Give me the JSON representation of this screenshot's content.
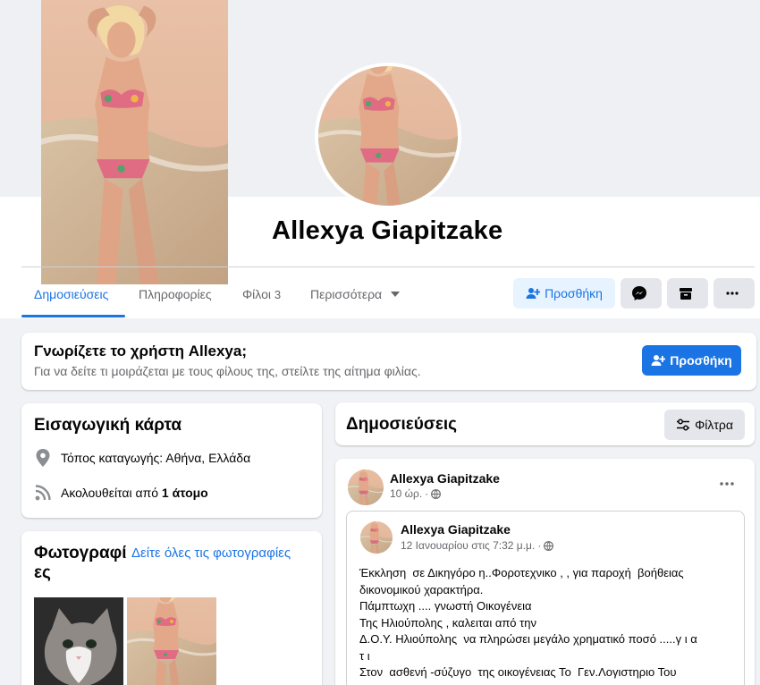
{
  "profile": {
    "name": "Allexya Giapitzake"
  },
  "tabs": [
    {
      "label": "Δημοσιεύσεις"
    },
    {
      "label": "Πληροφορίες"
    },
    {
      "label": "Φίλοι",
      "count": "3"
    },
    {
      "label": "Περισσότερα"
    }
  ],
  "header_actions": {
    "add_friend_label": "Προσθήκη"
  },
  "know_card": {
    "title": "Γνωρίζετε το χρήστη Allexya;",
    "subtitle": "Για να δείτε τι μοιράζεται με τους φίλους της, στείλτε της αίτημα φιλίας.",
    "button_label": "Προσθήκη"
  },
  "intro": {
    "title": "Εισαγωγική κάρτα",
    "hometown": "Τόπος καταγωγής: Αθήνα, Ελλάδα",
    "followed_prefix": "Ακολουθείται από ",
    "followed_count": "1 άτομο"
  },
  "photos": {
    "title": "Φωτογραφίες",
    "see_all": "Δείτε όλες τις φωτογραφίες"
  },
  "posts_header": {
    "title": "Δημοσιεύσεις",
    "filter_label": "Φίλτρα"
  },
  "post": {
    "author": "Allexya Giapitzake",
    "time": "10 ώρ.",
    "shared": {
      "author": "Allexya Giapitzake",
      "time": "12 Ιανουαρίου στις 7:32 μ.μ.",
      "lines": [
        "Έκκληση  σε Δικηγόρο η..Φοροτεχνικο , , για παροχή  βοήθειας",
        "δικονομικού χαρακτήρα.",
        "Πάμπτωχη .... γνωστή Οικογένεια",
        "Της Ηλιούπολης , καλειται από την",
        "Δ.Ο.Υ. Ηλιούπολης  να πληρώσει μεγάλο χρηματικό ποσό .....γ ι α",
        "τ ι",
        "Στον  ασθενή -σύζυγο  της οικογένειας Το  Γεν.Λογιστηριο Του"
      ]
    }
  },
  "colors": {
    "accent": "#1b74e4",
    "page_bg": "#f0f2f5",
    "secondary_text": "#65676b"
  },
  "icons": {
    "add_friend": "person-plus-icon",
    "messenger": "messenger-icon",
    "gift_box": "box-icon",
    "more": "more-horizontal-icon",
    "location": "location-pin-icon",
    "followers": "rss-icon",
    "filter": "sliders-icon",
    "privacy": "globe-icon"
  }
}
